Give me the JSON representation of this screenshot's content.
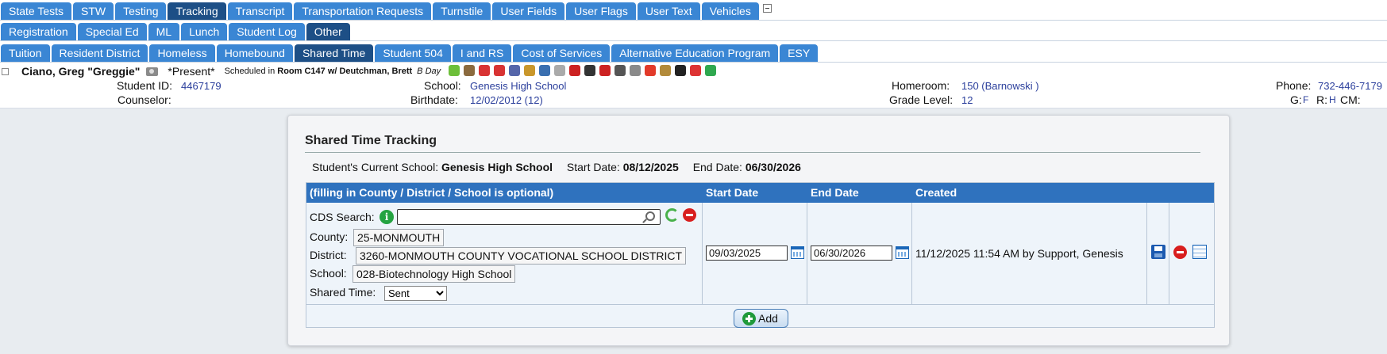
{
  "nav": {
    "row1": [
      {
        "label": "State Tests",
        "selected": false
      },
      {
        "label": "STW",
        "selected": false
      },
      {
        "label": "Testing",
        "selected": false
      },
      {
        "label": "Tracking",
        "selected": true
      },
      {
        "label": "Transcript",
        "selected": false
      },
      {
        "label": "Transportation Requests",
        "selected": false
      },
      {
        "label": "Turnstile",
        "selected": false
      },
      {
        "label": "User Fields",
        "selected": false
      },
      {
        "label": "User Flags",
        "selected": false
      },
      {
        "label": "User Text",
        "selected": false
      },
      {
        "label": "Vehicles",
        "selected": false
      }
    ],
    "row2": [
      {
        "label": "Registration",
        "selected": false
      },
      {
        "label": "Special Ed",
        "selected": false
      },
      {
        "label": "ML",
        "selected": false
      },
      {
        "label": "Lunch",
        "selected": false
      },
      {
        "label": "Student Log",
        "selected": false
      },
      {
        "label": "Other",
        "selected": true
      }
    ],
    "row3": [
      {
        "label": "Tuition",
        "selected": false
      },
      {
        "label": "Resident District",
        "selected": false
      },
      {
        "label": "Homeless",
        "selected": false
      },
      {
        "label": "Homebound",
        "selected": false
      },
      {
        "label": "Shared Time",
        "selected": true
      },
      {
        "label": "Student 504",
        "selected": false
      },
      {
        "label": "I and RS",
        "selected": false
      },
      {
        "label": "Cost of Services",
        "selected": false
      },
      {
        "label": "Alternative Education Program",
        "selected": false
      },
      {
        "label": "ESY",
        "selected": false
      }
    ]
  },
  "student": {
    "name": "Ciano, Greg \"Greggie\"",
    "present": "*Present*",
    "scheduled_prefix": "Scheduled in ",
    "room": "Room C147 w/ Deutchman, Brett",
    "day": "B Day",
    "flag_colors": [
      "#6dbf3a",
      "#8b6a3e",
      "#d83333",
      "#d83333",
      "#5566aa",
      "#c9972b",
      "#3a6fb0",
      "#aaaaaa",
      "#cc2222",
      "#333333",
      "#c22",
      "#555555",
      "#8a8a8a",
      "#e23a2a",
      "#b28a3a",
      "#222222",
      "#d33",
      "#2fa84f"
    ],
    "id_label": "Student ID:",
    "id_value": "4467179",
    "counselor_label": "Counselor:",
    "school_label": "School:",
    "school_value": "Genesis High School",
    "birthdate_label": "Birthdate:",
    "birthdate_value": "12/02/2012 (12)",
    "homeroom_label": "Homeroom:",
    "homeroom_value": "150 (Barnowski )",
    "grade_label": "Grade Level:",
    "grade_value": "12",
    "phone_label": "Phone:",
    "phone_value": "732-446-7179",
    "g_label": "G:",
    "g_value": "F",
    "r_label": "R:",
    "r_value": "H",
    "cm_label": "CM:"
  },
  "panel": {
    "title": "Shared Time Tracking",
    "current_school_label": "Student's Current School:",
    "current_school": "Genesis High School",
    "start_label": "Start Date:",
    "start_value": "08/12/2025",
    "end_label": "End Date:",
    "end_value": "06/30/2026"
  },
  "grid": {
    "col_main": "(filling in County / District / School is optional)",
    "col_start": "Start Date",
    "col_end": "End Date",
    "col_created": "Created",
    "cds_label": "CDS Search:",
    "county_label": "County:",
    "county_value": "25-MONMOUTH",
    "district_label": "District:",
    "district_value": "3260-MONMOUTH COUNTY VOCATIONAL SCHOOL DISTRICT",
    "school_label": "School:",
    "school_value": "028-Biotechnology High School",
    "shared_label": "Shared Time:",
    "shared_value": "Sent",
    "start_date": "09/03/2025",
    "end_date": "06/30/2026",
    "created": "11/12/2025 11:54 AM by Support, Genesis",
    "add_label": "Add"
  }
}
